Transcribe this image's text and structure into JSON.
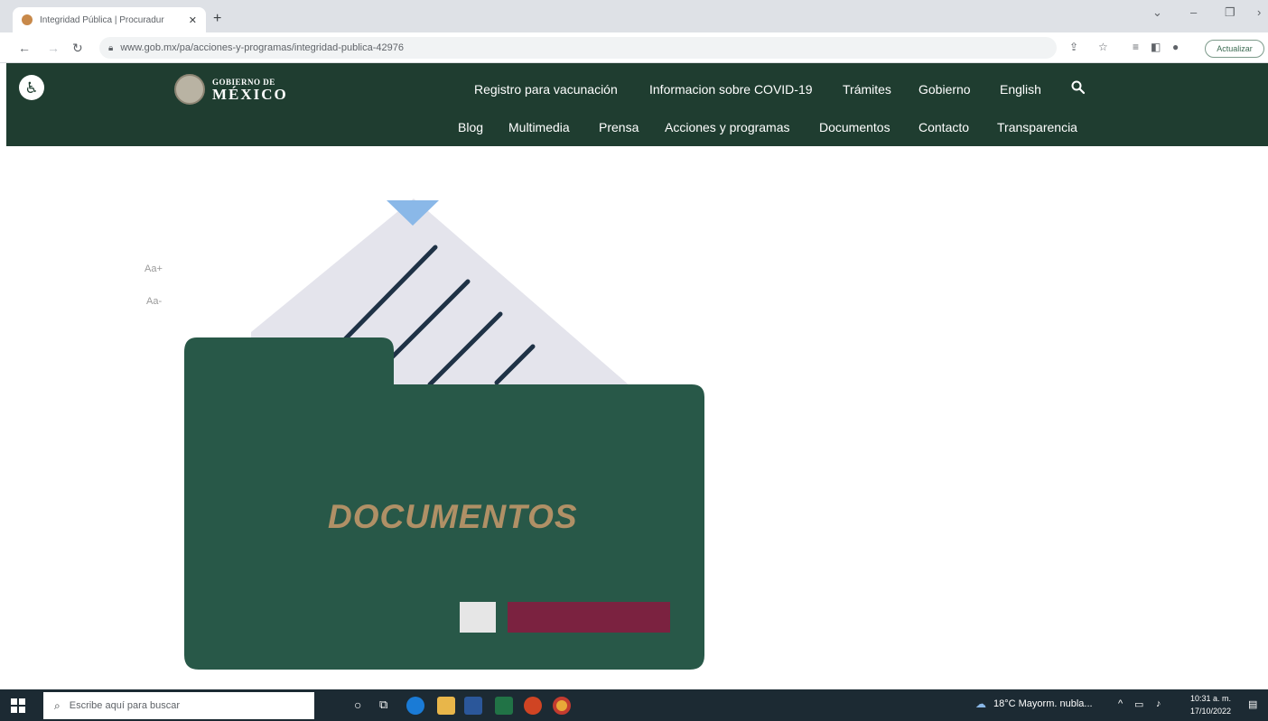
{
  "browser": {
    "tab_title": "Integridad Pública | Procuradur",
    "tab_close": "✕",
    "new_tab": "+",
    "url": "www.gob.mx/pa/acciones-y-programas/integridad-publica-42976",
    "update_label": "Actualizar"
  },
  "header": {
    "logo_line1": "GOBIERNO DE",
    "logo_line2": "MÉXICO",
    "nav_top": [
      "Registro para vacunación",
      "Informacion sobre COVID-19",
      "Trámites",
      "Gobierno",
      "English"
    ],
    "nav_bottom": [
      "Blog",
      "Multimedia",
      "Prensa",
      "Acciones y programas",
      "Documentos",
      "Contacto",
      "Transparencia"
    ]
  },
  "page": {
    "font_increase": "Aa+",
    "font_decrease": "Aa-",
    "hero_word": "DOCUMENTOS"
  },
  "taskbar": {
    "search_placeholder": "Escribe aquí para buscar",
    "weather": "18°C  Mayorm. nubla...",
    "time": "10:31 a. m.",
    "date": "17/10/2022"
  },
  "colors": {
    "header_green": "#1f3d30",
    "folder_green": "#285848",
    "accent_gold": "#b09066",
    "accent_maroon": "#7b2240"
  }
}
